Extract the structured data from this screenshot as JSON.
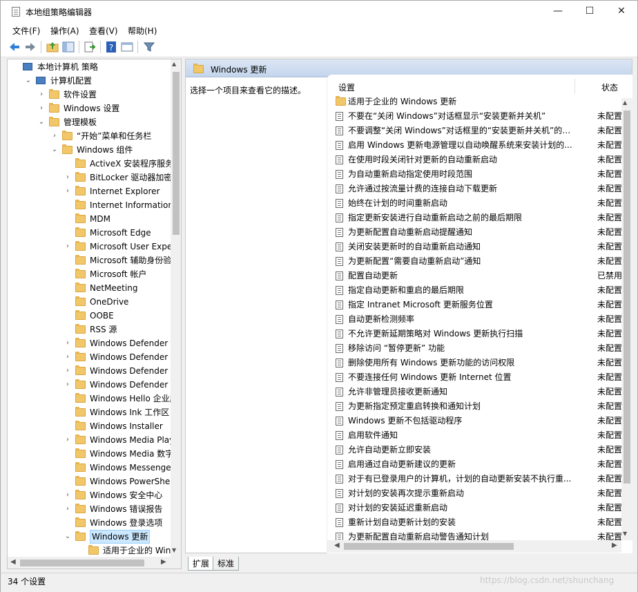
{
  "window": {
    "title": "本地组策略编辑器",
    "min": "—",
    "max": "☐",
    "close": "✕"
  },
  "menu": [
    "文件(F)",
    "操作(A)",
    "查看(V)",
    "帮助(H)"
  ],
  "toolbar_icons": [
    "back-icon",
    "forward-icon",
    "up-folder-icon",
    "show-hide-tree-icon",
    "export-list-icon",
    "help-icon",
    "properties-icon",
    "filter-icon"
  ],
  "tree": [
    {
      "label": "本地计算机 策略",
      "level": 0,
      "arrow": "",
      "icon": "computer"
    },
    {
      "label": "计算机配置",
      "level": 1,
      "arrow": "v",
      "icon": "computer"
    },
    {
      "label": "软件设置",
      "level": 2,
      "arrow": ">",
      "icon": "folder"
    },
    {
      "label": "Windows 设置",
      "level": 2,
      "arrow": ">",
      "icon": "folder"
    },
    {
      "label": "管理模板",
      "level": 2,
      "arrow": "v",
      "icon": "folder"
    },
    {
      "label": "“开始”菜单和任务栏",
      "level": 3,
      "arrow": ">",
      "icon": "folder"
    },
    {
      "label": "Windows 组件",
      "level": 3,
      "arrow": "v",
      "icon": "folder"
    },
    {
      "label": "ActiveX 安装程序服务",
      "level": 4,
      "arrow": "",
      "icon": "folder"
    },
    {
      "label": "BitLocker 驱动器加密",
      "level": 4,
      "arrow": ">",
      "icon": "folder"
    },
    {
      "label": "Internet Explorer",
      "level": 4,
      "arrow": ">",
      "icon": "folder"
    },
    {
      "label": "Internet Information Se",
      "level": 4,
      "arrow": "",
      "icon": "folder"
    },
    {
      "label": "MDM",
      "level": 4,
      "arrow": "",
      "icon": "folder"
    },
    {
      "label": "Microsoft Edge",
      "level": 4,
      "arrow": "",
      "icon": "folder"
    },
    {
      "label": "Microsoft User Experie",
      "level": 4,
      "arrow": ">",
      "icon": "folder"
    },
    {
      "label": "Microsoft 辅助身份验证",
      "level": 4,
      "arrow": "",
      "icon": "folder"
    },
    {
      "label": "Microsoft 帐户",
      "level": 4,
      "arrow": "",
      "icon": "folder"
    },
    {
      "label": "NetMeeting",
      "level": 4,
      "arrow": "",
      "icon": "folder"
    },
    {
      "label": "OneDrive",
      "level": 4,
      "arrow": "",
      "icon": "folder"
    },
    {
      "label": "OOBE",
      "level": 4,
      "arrow": "",
      "icon": "folder"
    },
    {
      "label": "RSS 源",
      "level": 4,
      "arrow": "",
      "icon": "folder"
    },
    {
      "label": "Windows Defender Sma",
      "level": 4,
      "arrow": ">",
      "icon": "folder"
    },
    {
      "label": "Windows Defender 防病",
      "level": 4,
      "arrow": ">",
      "icon": "folder"
    },
    {
      "label": "Windows Defender 攻击",
      "level": 4,
      "arrow": ">",
      "icon": "folder"
    },
    {
      "label": "Windows Defender 应用",
      "level": 4,
      "arrow": ">",
      "icon": "folder"
    },
    {
      "label": "Windows Hello 企业版",
      "level": 4,
      "arrow": "",
      "icon": "folder"
    },
    {
      "label": "Windows Ink 工作区",
      "level": 4,
      "arrow": "",
      "icon": "folder"
    },
    {
      "label": "Windows Installer",
      "level": 4,
      "arrow": "",
      "icon": "folder"
    },
    {
      "label": "Windows Media Player",
      "level": 4,
      "arrow": ">",
      "icon": "folder"
    },
    {
      "label": "Windows Media 数字权",
      "level": 4,
      "arrow": "",
      "icon": "folder"
    },
    {
      "label": "Windows Messenger",
      "level": 4,
      "arrow": "",
      "icon": "folder"
    },
    {
      "label": "Windows PowerShell",
      "level": 4,
      "arrow": "",
      "icon": "folder"
    },
    {
      "label": "Windows 安全中心",
      "level": 4,
      "arrow": ">",
      "icon": "folder"
    },
    {
      "label": "Windows 错误报告",
      "level": 4,
      "arrow": ">",
      "icon": "folder"
    },
    {
      "label": "Windows 登录选项",
      "level": 4,
      "arrow": "",
      "icon": "folder"
    },
    {
      "label": "Windows 更新",
      "level": 4,
      "arrow": "v",
      "icon": "folder",
      "selected": true
    },
    {
      "label": "适用于企业的 Windov",
      "level": 5,
      "arrow": "",
      "icon": "folder"
    }
  ],
  "right": {
    "header": "Windows 更新",
    "description": "选择一个项目来查看它的描述。",
    "columns": {
      "setting": "设置",
      "state": "状态"
    },
    "folder_row": "适用于企业的 Windows 更新",
    "rows": [
      {
        "name": "不要在“关闭 Windows”对话框显示“安装更新并关机”",
        "state": "未配置"
      },
      {
        "name": "不要调整“关闭 Windows”对话框里的“安装更新并关机”的默...",
        "state": "未配置"
      },
      {
        "name": "启用 Windows 更新电源管理以自动唤醒系统来安装计划的...",
        "state": "未配置"
      },
      {
        "name": "在使用时段关闭针对更新的自动重新启动",
        "state": "未配置"
      },
      {
        "name": "为自动重新启动指定使用时段范围",
        "state": "未配置"
      },
      {
        "name": "允许通过按流量计费的连接自动下载更新",
        "state": "未配置"
      },
      {
        "name": "始终在计划的时间重新启动",
        "state": "未配置"
      },
      {
        "name": "指定更新安装进行自动重新启动之前的最后期限",
        "state": "未配置"
      },
      {
        "name": "为更新配置自动重新启动提醒通知",
        "state": "未配置"
      },
      {
        "name": "关闭安装更新时的自动重新启动通知",
        "state": "未配置"
      },
      {
        "name": "为更新配置“需要自动重新启动”通知",
        "state": "未配置"
      },
      {
        "name": "配置自动更新",
        "state": "已禁用"
      },
      {
        "name": "指定自动更新和重启的最后期限",
        "state": "未配置"
      },
      {
        "name": "指定 Intranet Microsoft 更新服务位置",
        "state": "未配置"
      },
      {
        "name": "自动更新检测频率",
        "state": "未配置"
      },
      {
        "name": "不允许更新延期策略对 Windows 更新执行扫描",
        "state": "未配置"
      },
      {
        "name": "移除访问 “暂停更新” 功能",
        "state": "未配置"
      },
      {
        "name": "删除使用所有 Windows 更新功能的访问权限",
        "state": "未配置"
      },
      {
        "name": "不要连接任何 Windows 更新 Internet 位置",
        "state": "未配置"
      },
      {
        "name": "允许非管理员接收更新通知",
        "state": "未配置"
      },
      {
        "name": "为更新指定预定重启转换和通知计划",
        "state": "未配置"
      },
      {
        "name": "Windows 更新不包括驱动程序",
        "state": "未配置"
      },
      {
        "name": "启用软件通知",
        "state": "未配置"
      },
      {
        "name": "允许自动更新立即安装",
        "state": "未配置"
      },
      {
        "name": "启用通过自动更新建议的更新",
        "state": "未配置"
      },
      {
        "name": "对于有已登录用户的计算机，计划的自动更新安装不执行重...",
        "state": "未配置"
      },
      {
        "name": "对计划的安装再次提示重新启动",
        "state": "未配置"
      },
      {
        "name": "对计划的安装延迟重新启动",
        "state": "未配置"
      },
      {
        "name": "重新计划自动更新计划的安装",
        "state": "未配置"
      },
      {
        "name": "为更新配置自动重新启动警告通知计划",
        "state": "未配置"
      }
    ]
  },
  "tabs": [
    "扩展",
    "标准"
  ],
  "status": "34 个设置",
  "watermark": "https://blog.csdn.net/shunchang"
}
